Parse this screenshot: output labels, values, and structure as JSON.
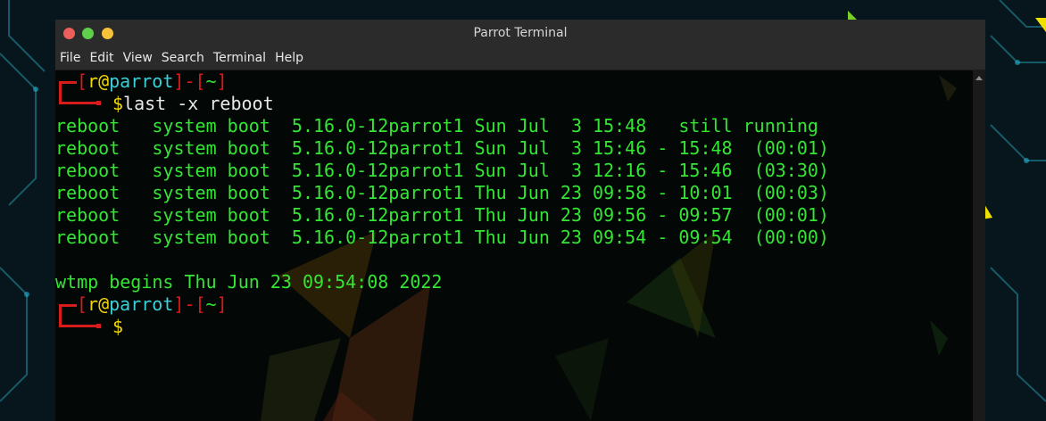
{
  "window": {
    "title": "Parrot Terminal"
  },
  "menu": [
    "File",
    "Edit",
    "View",
    "Search",
    "Terminal",
    "Help"
  ],
  "prompt": {
    "open": "[",
    "user": "r",
    "at": "@",
    "host": "parrot",
    "close": "]",
    "dash": "-",
    "dir_open": "[",
    "dir": "~",
    "dir_close": "]",
    "symbol": "$"
  },
  "command": "last -x reboot",
  "rows": [
    "reboot   system boot  5.16.0-12parrot1 Sun Jul  3 15:48   still running",
    "reboot   system boot  5.16.0-12parrot1 Sun Jul  3 15:46 - 15:48  (00:01)",
    "reboot   system boot  5.16.0-12parrot1 Sun Jul  3 12:16 - 15:46  (03:30)",
    "reboot   system boot  5.16.0-12parrot1 Thu Jun 23 09:58 - 10:01  (00:03)",
    "reboot   system boot  5.16.0-12parrot1 Thu Jun 23 09:56 - 09:57  (00:01)",
    "reboot   system boot  5.16.0-12parrot1 Thu Jun 23 09:54 - 09:54  (00:00)"
  ],
  "wtmp": "wtmp begins Thu Jun 23 09:54:08 2022"
}
